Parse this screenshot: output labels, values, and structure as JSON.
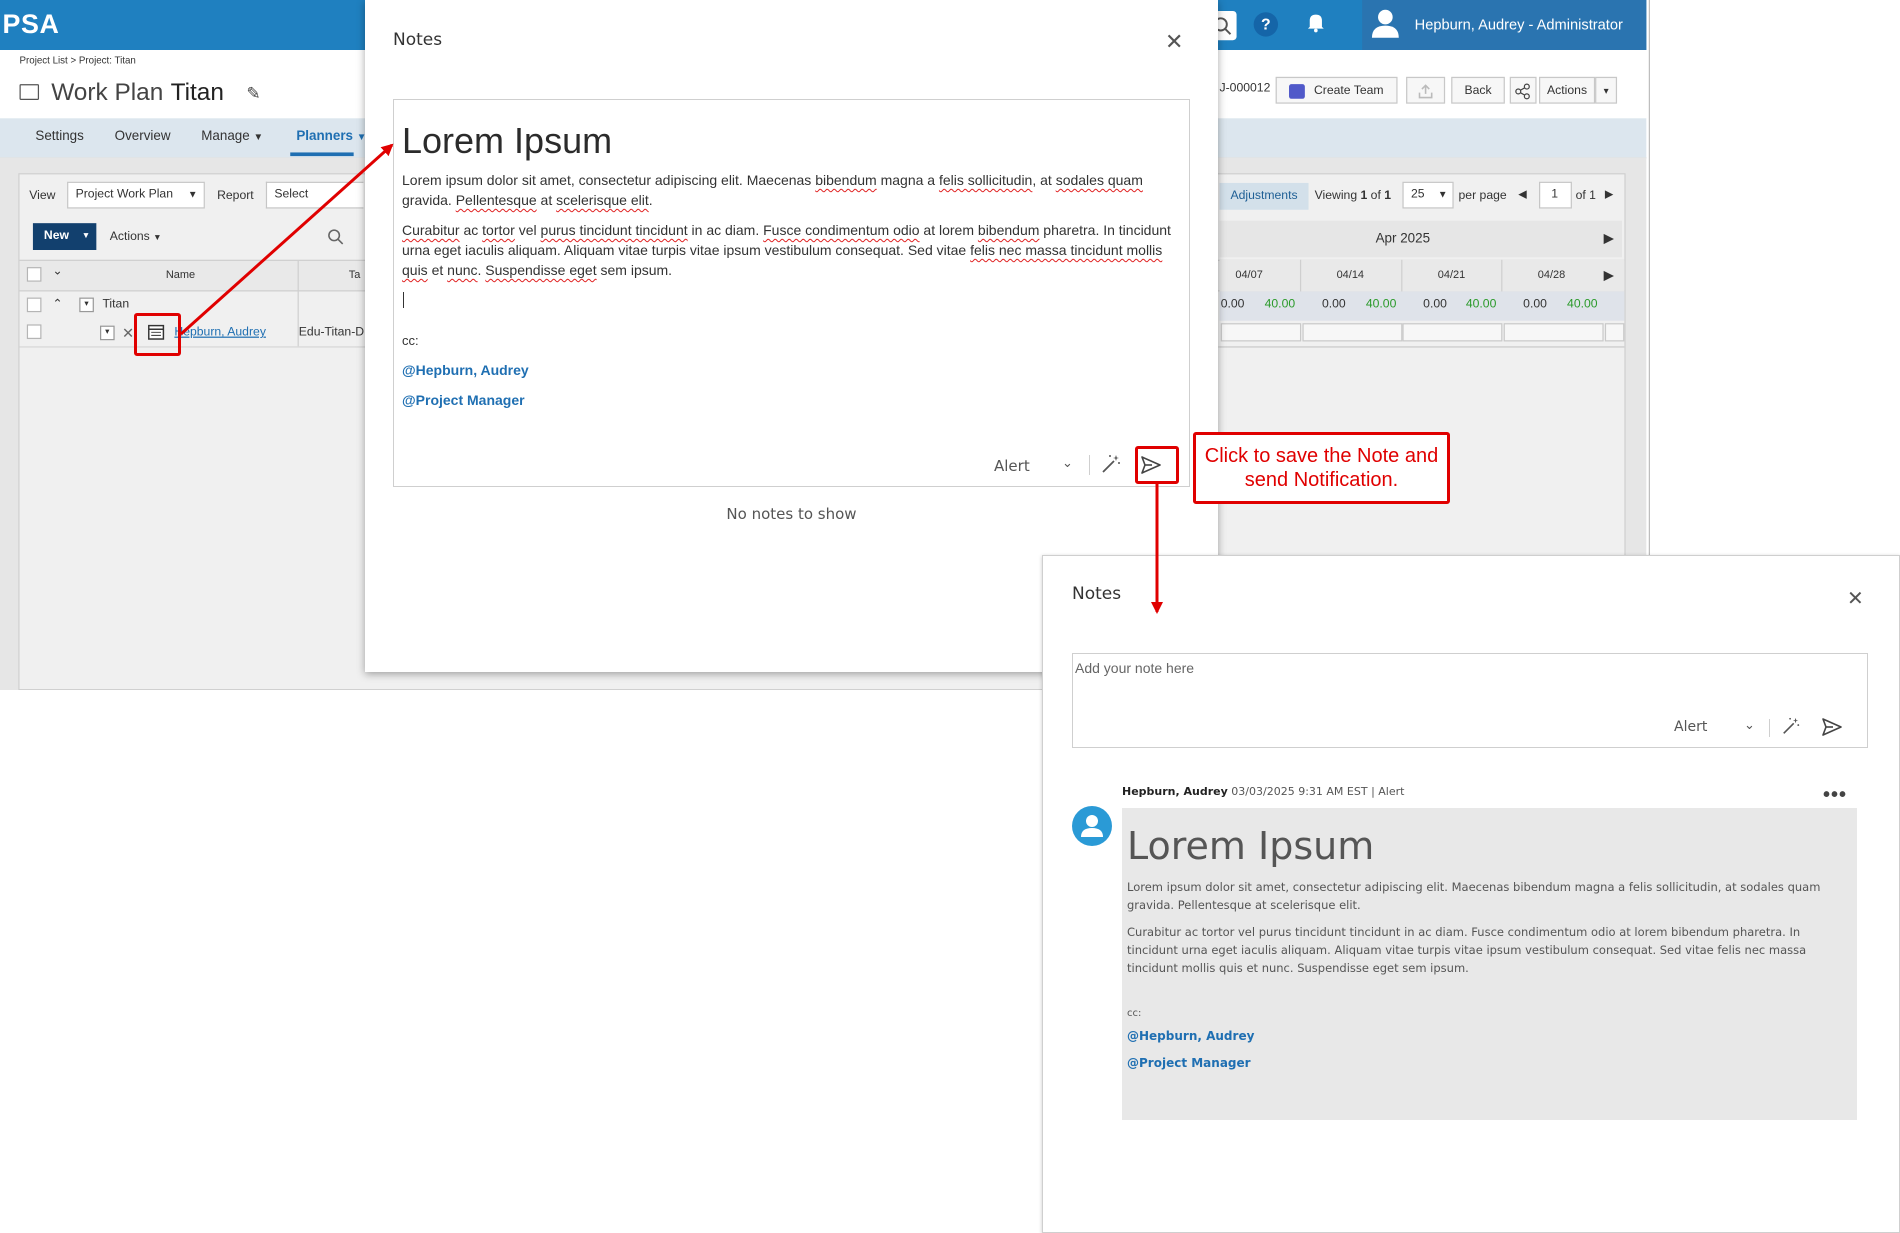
{
  "app": {
    "logo": "PSA",
    "user_label": "Hepburn, Audrey - Administrator",
    "breadcrumb": "Project List > Project: Titan",
    "title_prefix": "Work Plan",
    "title_name": "Titan",
    "project_id": "J-000012",
    "buttons": {
      "create_team": "Create Team",
      "back": "Back",
      "actions": "Actions"
    },
    "tabs": [
      "Settings",
      "Overview",
      "Manage",
      "Planners"
    ],
    "active_tab": "Planners",
    "toolbar": {
      "view_label": "View",
      "view_value": "Project Work Plan",
      "report_label": "Report",
      "report_value": "Select",
      "new_label": "New",
      "actions_label": "Actions",
      "adjustments_label": "Adjustments",
      "viewing_prefix": "Viewing",
      "viewing_cur": "1",
      "viewing_mid": "of",
      "viewing_total": "1",
      "per_page_value": "25",
      "per_page_label": "per page",
      "page_value": "1",
      "page_of": "of 1"
    },
    "grid": {
      "name_header": "Name",
      "task_header_fragment": "Ta",
      "month": "Apr 2025",
      "weeks": [
        "04/07",
        "04/14",
        "04/21",
        "04/28"
      ],
      "rows": [
        {
          "name": "Titan"
        },
        {
          "name": "Hepburn, Audrey",
          "task": "Edu-Titan-D"
        }
      ],
      "values": [
        [
          "0.00",
          "40.00"
        ],
        [
          "0.00",
          "40.00"
        ],
        [
          "0.00",
          "40.00"
        ],
        [
          "0.00",
          "40.00"
        ]
      ]
    }
  },
  "dialog_edit": {
    "title": "Notes",
    "heading": "Lorem Ipsum",
    "para1_a": "Lorem ipsum dolor sit amet, consectetur adipiscing elit. Maecenas ",
    "para1_sq1": "bibendum",
    "para1_b": " magna a ",
    "para1_sq2": "felis sollicitudin",
    "para1_c": ", at ",
    "para1_sq3": "sodales quam",
    "para1_d": " gravida. ",
    "para1_sq4": "Pellentesque",
    "para1_e": " at ",
    "para1_sq5": "scelerisque elit",
    "para1_f": ".",
    "para2_sq1": "Curabitur",
    "para2_a": " ac ",
    "para2_sq2": "tortor",
    "para2_b": " vel ",
    "para2_sq3": "purus tincidunt tincidunt",
    "para2_c": " in ac diam. ",
    "para2_sq4": "Fusce condimentum odio",
    "para2_d": " at lorem ",
    "para2_sq5": "bibendum",
    "para2_e": " pharetra. In tincidunt urna eget iaculis aliquam. Aliquam vitae turpis vitae ipsum vestibulum consequat. Sed vitae ",
    "para2_sq6": "felis nec massa tincidunt mollis quis",
    "para2_f": " et ",
    "para2_sq7": "nunc",
    "para2_g": ". ",
    "para2_sq8": "Suspendisse eget",
    "para2_h": " sem ipsum.",
    "cc": "cc:",
    "mention1": "@Hepburn, Audrey",
    "mention2": "@Project Manager",
    "alert_label": "Alert",
    "empty_message": "No notes to show"
  },
  "callout_text": "Click to save the Note and send Notification.",
  "dialog_result": {
    "title": "Notes",
    "placeholder": "Add your note here",
    "alert_label": "Alert",
    "author": "Hepburn, Audrey",
    "timestamp": "03/03/2025 9:31 AM EST",
    "separator": "|",
    "type": "Alert",
    "heading": "Lorem Ipsum",
    "para1": "Lorem ipsum dolor sit amet, consectetur adipiscing elit. Maecenas bibendum magna a felis sollicitudin, at sodales quam gravida. Pellentesque at scelerisque elit.",
    "para2": "Curabitur ac tortor vel purus tincidunt tincidunt in ac diam. Fusce condimentum odio at lorem bibendum pharetra. In tincidunt urna eget iaculis aliquam. Aliquam vitae turpis vitae ipsum vestibulum consequat. Sed vitae felis nec massa tincidunt mollis quis et nunc. Suspendisse eget sem ipsum.",
    "cc": "cc:",
    "mention1": "@Hepburn, Audrey",
    "mention2": "@Project Manager"
  },
  "colors": {
    "brand": "#1f80c0",
    "mention": "#1f6fb2",
    "annotation": "#e00000",
    "positive": "#2a9a2a"
  }
}
